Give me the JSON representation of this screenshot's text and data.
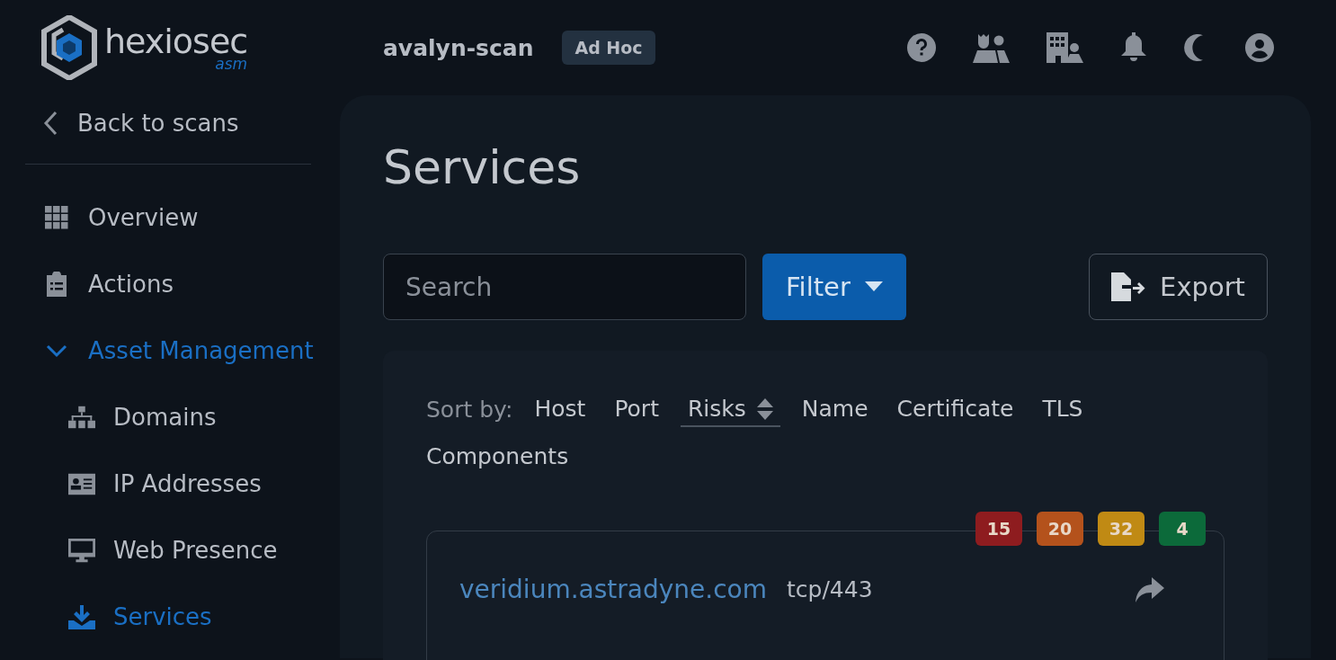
{
  "brand": {
    "name": "hexiosec",
    "sub": "asm"
  },
  "scan": {
    "name": "avalyn-scan",
    "badge": "Ad Hoc"
  },
  "sidebar": {
    "back": "Back to scans",
    "items": [
      {
        "label": "Overview",
        "kind": "grid",
        "selected": false
      },
      {
        "label": "Actions",
        "kind": "clipboard",
        "selected": false
      },
      {
        "label": "Asset Management",
        "kind": "group",
        "expanded": true,
        "children": [
          {
            "label": "Domains",
            "kind": "sitemap",
            "selected": false
          },
          {
            "label": "IP Addresses",
            "kind": "idcard",
            "selected": false
          },
          {
            "label": "Web Presence",
            "kind": "monitor",
            "selected": false
          },
          {
            "label": "Services",
            "kind": "download",
            "selected": true
          }
        ]
      }
    ]
  },
  "page": {
    "title": "Services",
    "search": {
      "placeholder": "Search"
    },
    "filter": "Filter",
    "export": "Export",
    "sort_label": "Sort by:",
    "sort_options": [
      {
        "label": "Host",
        "selected": false
      },
      {
        "label": "Port",
        "selected": false
      },
      {
        "label": "Risks",
        "selected": true
      },
      {
        "label": "Name",
        "selected": false
      },
      {
        "label": "Certificate",
        "selected": false
      },
      {
        "label": "TLS",
        "selected": false
      },
      {
        "label": "Components",
        "selected": false
      }
    ],
    "services": [
      {
        "host": "veridium.astradyne.com",
        "port": "tcp/443",
        "risks": [
          {
            "count": "15",
            "color": "#8e1c1f"
          },
          {
            "count": "20",
            "color": "#b4521c"
          },
          {
            "count": "32",
            "color": "#c08a14"
          },
          {
            "count": "4",
            "color": "#0c6a3a"
          }
        ]
      }
    ]
  }
}
